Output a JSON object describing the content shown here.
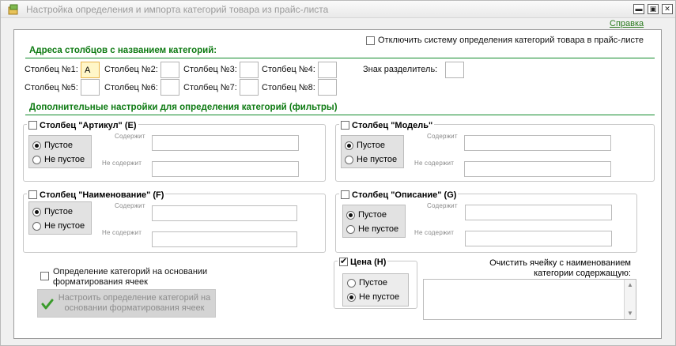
{
  "window": {
    "title": "Настройка определения и импорта категорий товара из прайс-листа",
    "minimize_label": "▬",
    "maximize_label": "▣",
    "close_label": "✕"
  },
  "help_link": "Справка",
  "disable_checkbox": {
    "label": "Отключить систему определения категорий товара в прайс-листе",
    "checked": false
  },
  "section_columns": {
    "title": "Адреса столбцов с названием категорий:",
    "columns": [
      {
        "label": "Столбец №1:",
        "value": "A"
      },
      {
        "label": "Столбец №2:",
        "value": ""
      },
      {
        "label": "Столбец №3:",
        "value": ""
      },
      {
        "label": "Столбец №4:",
        "value": ""
      },
      {
        "label": "Столбец №5:",
        "value": ""
      },
      {
        "label": "Столбец №6:",
        "value": ""
      },
      {
        "label": "Столбец №7:",
        "value": ""
      },
      {
        "label": "Столбец №8:",
        "value": ""
      }
    ],
    "separator_label": "Знак разделитель:",
    "separator_value": ""
  },
  "section_filters": {
    "title": "Дополнительные настройки для определения категорий (фильтры)",
    "contains_label": "Содержит",
    "not_contains_label": "Не содержит",
    "empty_label": "Пустое",
    "not_empty_label": "Не пустое",
    "groups": {
      "article": {
        "title": "Столбец \"Артикул\" (E)",
        "checked": false,
        "selected": "empty"
      },
      "model": {
        "title": "Столбец \"Модель\"",
        "checked": false,
        "selected": "empty"
      },
      "name": {
        "title": "Столбец \"Наименование\" (F)",
        "checked": false,
        "selected": "empty"
      },
      "description": {
        "title": "Столбец \"Описание\" (G)",
        "checked": false,
        "selected": "empty"
      },
      "price": {
        "title": "Цена (H)",
        "checked": true,
        "selected": "not_empty"
      }
    }
  },
  "format_detection": {
    "label": "Определение категорий на основании форматирования ячеек",
    "checked": false,
    "button_label": "Настроить определение категорий на основании форматирования ячеек"
  },
  "clear_cell": {
    "label": "Очистить ячейку с наименованием категории содержащую:",
    "value": ""
  },
  "colors": {
    "accent_green": "#0d7a12",
    "link_green": "#2a7a1e",
    "active_input": "#fff6c8"
  }
}
